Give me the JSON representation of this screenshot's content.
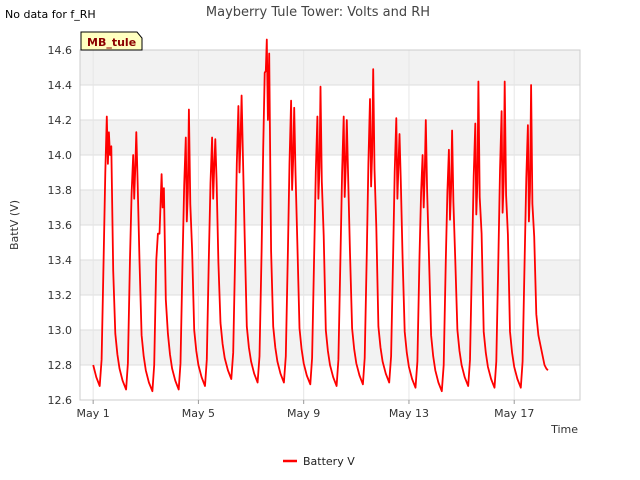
{
  "page": {
    "nodata_note": "No data for f_RH",
    "badge_label": "MB_tule"
  },
  "chart_data": {
    "type": "line",
    "title": "Mayberry Tule Tower: Volts and RH",
    "xlabel": "Time",
    "ylabel": "BattV (V)",
    "xlim": [
      "2024-04-30T12:00",
      "2024-05-19T12:00"
    ],
    "ylim": [
      12.6,
      14.6
    ],
    "yticks": [
      12.6,
      12.8,
      13.0,
      13.2,
      13.4,
      13.6,
      13.8,
      14.0,
      14.2,
      14.4,
      14.6
    ],
    "xticks": [
      {
        "label": "May 1",
        "date": "2024-05-01"
      },
      {
        "label": "May 5",
        "date": "2024-05-05"
      },
      {
        "label": "May 9",
        "date": "2024-05-09"
      },
      {
        "label": "May 13",
        "date": "2024-05-13"
      },
      {
        "label": "May 17",
        "date": "2024-05-17"
      }
    ],
    "grid": true,
    "legend_position": "bottom-center",
    "series": [
      {
        "name": "Battery V",
        "color": "#ff0000",
        "daily_cycles": [
          {
            "date": "2024-05-01",
            "min": 12.68,
            "peaks": [
              14.22,
              13.95,
              14.0
            ]
          },
          {
            "date": "2024-05-02",
            "min": 12.66,
            "peaks": [
              14.0,
              13.75,
              14.13
            ]
          },
          {
            "date": "2024-05-03",
            "min": 12.65,
            "peaks": [
              13.55,
              13.71,
              13.7
            ]
          },
          {
            "date": "2024-05-04",
            "min": 12.66,
            "peaks": [
              14.1,
              13.62,
              14.26
            ]
          },
          {
            "date": "2024-05-05",
            "min": 12.68,
            "peaks": [
              14.1,
              13.75,
              14.09
            ]
          },
          {
            "date": "2024-05-06",
            "min": 12.72,
            "peaks": [
              14.28,
              13.9,
              14.34
            ]
          },
          {
            "date": "2024-05-07",
            "min": 12.7,
            "peaks": [
              14.47,
              14.48,
              14.2
            ]
          },
          {
            "date": "2024-05-08",
            "min": 12.7,
            "peaks": [
              14.31,
              13.8,
              14.27
            ]
          },
          {
            "date": "2024-05-09",
            "min": 12.69,
            "peaks": [
              14.22,
              13.75,
              14.39
            ]
          },
          {
            "date": "2024-05-10",
            "min": 12.68,
            "peaks": [
              14.22,
              13.76,
              14.2
            ]
          },
          {
            "date": "2024-05-11",
            "min": 12.69,
            "peaks": [
              14.32,
              13.82,
              14.49
            ]
          },
          {
            "date": "2024-05-12",
            "min": 12.7,
            "peaks": [
              14.21,
              13.75,
              14.12
            ]
          },
          {
            "date": "2024-05-13",
            "min": 12.67,
            "peaks": [
              14.0,
              13.7,
              14.2
            ]
          },
          {
            "date": "2024-05-14",
            "min": 12.65,
            "peaks": [
              14.03,
              13.63,
              14.14
            ]
          },
          {
            "date": "2024-05-15",
            "min": 12.68,
            "peaks": [
              14.18,
              13.66,
              14.42
            ]
          },
          {
            "date": "2024-05-16",
            "min": 12.67,
            "peaks": [
              14.25,
              13.67,
              14.42
            ]
          },
          {
            "date": "2024-05-17",
            "min": 12.67,
            "peaks": [
              14.17,
              13.62,
              14.4
            ]
          },
          {
            "date": "2024-05-18",
            "min": 12.77,
            "peaks": [
              12.8,
              12.78,
              12.77
            ]
          }
        ]
      }
    ]
  }
}
